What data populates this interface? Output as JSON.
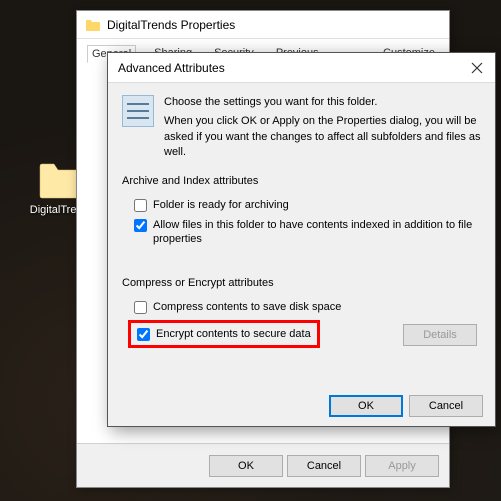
{
  "desktop": {
    "folder_label": "DigitalTrends"
  },
  "props": {
    "title": "DigitalTrends Properties",
    "tabs": [
      "General",
      "Sharing",
      "Security",
      "Previous Versions",
      "Customize"
    ],
    "ok": "OK",
    "cancel": "Cancel",
    "apply": "Apply"
  },
  "adv": {
    "title": "Advanced Attributes",
    "info1": "Choose the settings you want for this folder.",
    "info2": "When you click OK or Apply on the Properties dialog, you will be asked if you want the changes to affect all subfolders and files as well.",
    "group1": "Archive and Index attributes",
    "check1": "Folder is ready for archiving",
    "check2": "Allow files in this folder to have contents indexed in addition to file properties",
    "group2": "Compress or Encrypt attributes",
    "check3": "Compress contents to save disk space",
    "check4": "Encrypt contents to secure data",
    "details": "Details",
    "ok": "OK",
    "cancel": "Cancel"
  }
}
